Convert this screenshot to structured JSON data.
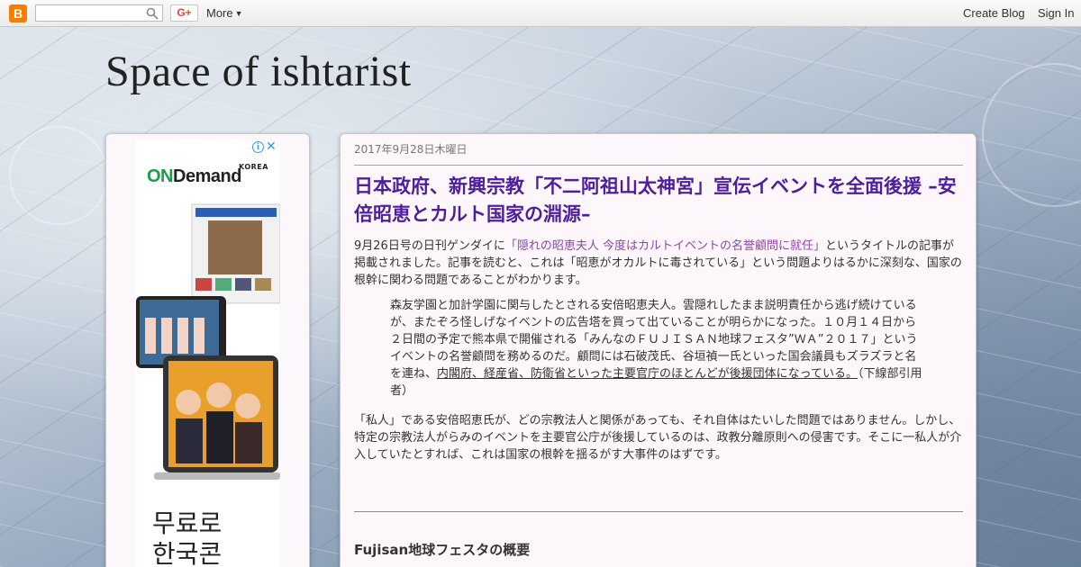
{
  "navbar": {
    "logo_letter": "B",
    "gplus_label": "G+",
    "more_label": "More",
    "create_blog_label": "Create Blog",
    "sign_in_label": "Sign In"
  },
  "blog": {
    "title": "Space of ishtarist"
  },
  "ad": {
    "info_label": "i",
    "close_label": "✕",
    "brand_on": "ON",
    "brand_rest": "Demand",
    "brand_country": "KOREA",
    "tagline_line1": "무료로",
    "tagline_line2": "한국콘"
  },
  "post": {
    "date": "2017年9月28日木曜日",
    "title": "日本政府、新興宗教「不二阿祖山太神宮」宣伝イベントを全面後援 –安倍昭恵とカルト国家の淵源–",
    "para1_prefix": "9月26日号の日刊ゲンダイに",
    "para1_link": "「隠れの昭恵夫人 今度はカルトイベントの名誉顧問に就任」",
    "para1_suffix": "というタイトルの記事が掲載されました。記事を読むと、これは「昭恵がオカルトに毒されている」という問題よりはるかに深刻な、国家の根幹に関わる問題であることがわかります。",
    "quote_text": "森友学園と加計学園に関与したとされる安倍昭恵夫人。雲隠れしたまま説明責任から逃げ続けているが、またぞろ怪しげなイベントの広告塔を買って出ていることが明らかになった。１０月１４日から２日間の予定で熊本県で開催される「みんなのＦＵＪＩＳＡＮ地球フェスタ”ＷＡ”２０１７」というイベントの名誉顧問を務めるのだ。顧問には石破茂氏、谷垣禎一氏といった国会議員もズラズラと名を連ね、",
    "quote_underlined": "内閣府、経産省、防衛省といった主要官庁のほとんどが後援団体になっている。",
    "quote_note": "（下線部引用者）",
    "para2": "「私人」である安倍昭恵氏が、どの宗教法人と関係があっても、それ自体はたいした問題ではありません。しかし、特定の宗教法人がらみのイベントを主要官公庁が後援しているのは、政教分離原則への侵害です。そこに一私人が介入していたとすれば、これは国家の根幹を揺るがす大事件のはずです。",
    "subheading": "Fujisan地球フェスタの概要"
  },
  "colors": {
    "post_title": "#4f1e9c",
    "link": "#8e44ad",
    "blogger_orange": "#f57d00",
    "gplus_red": "#dd4b39",
    "ondemand_green": "#1d9a4a"
  }
}
